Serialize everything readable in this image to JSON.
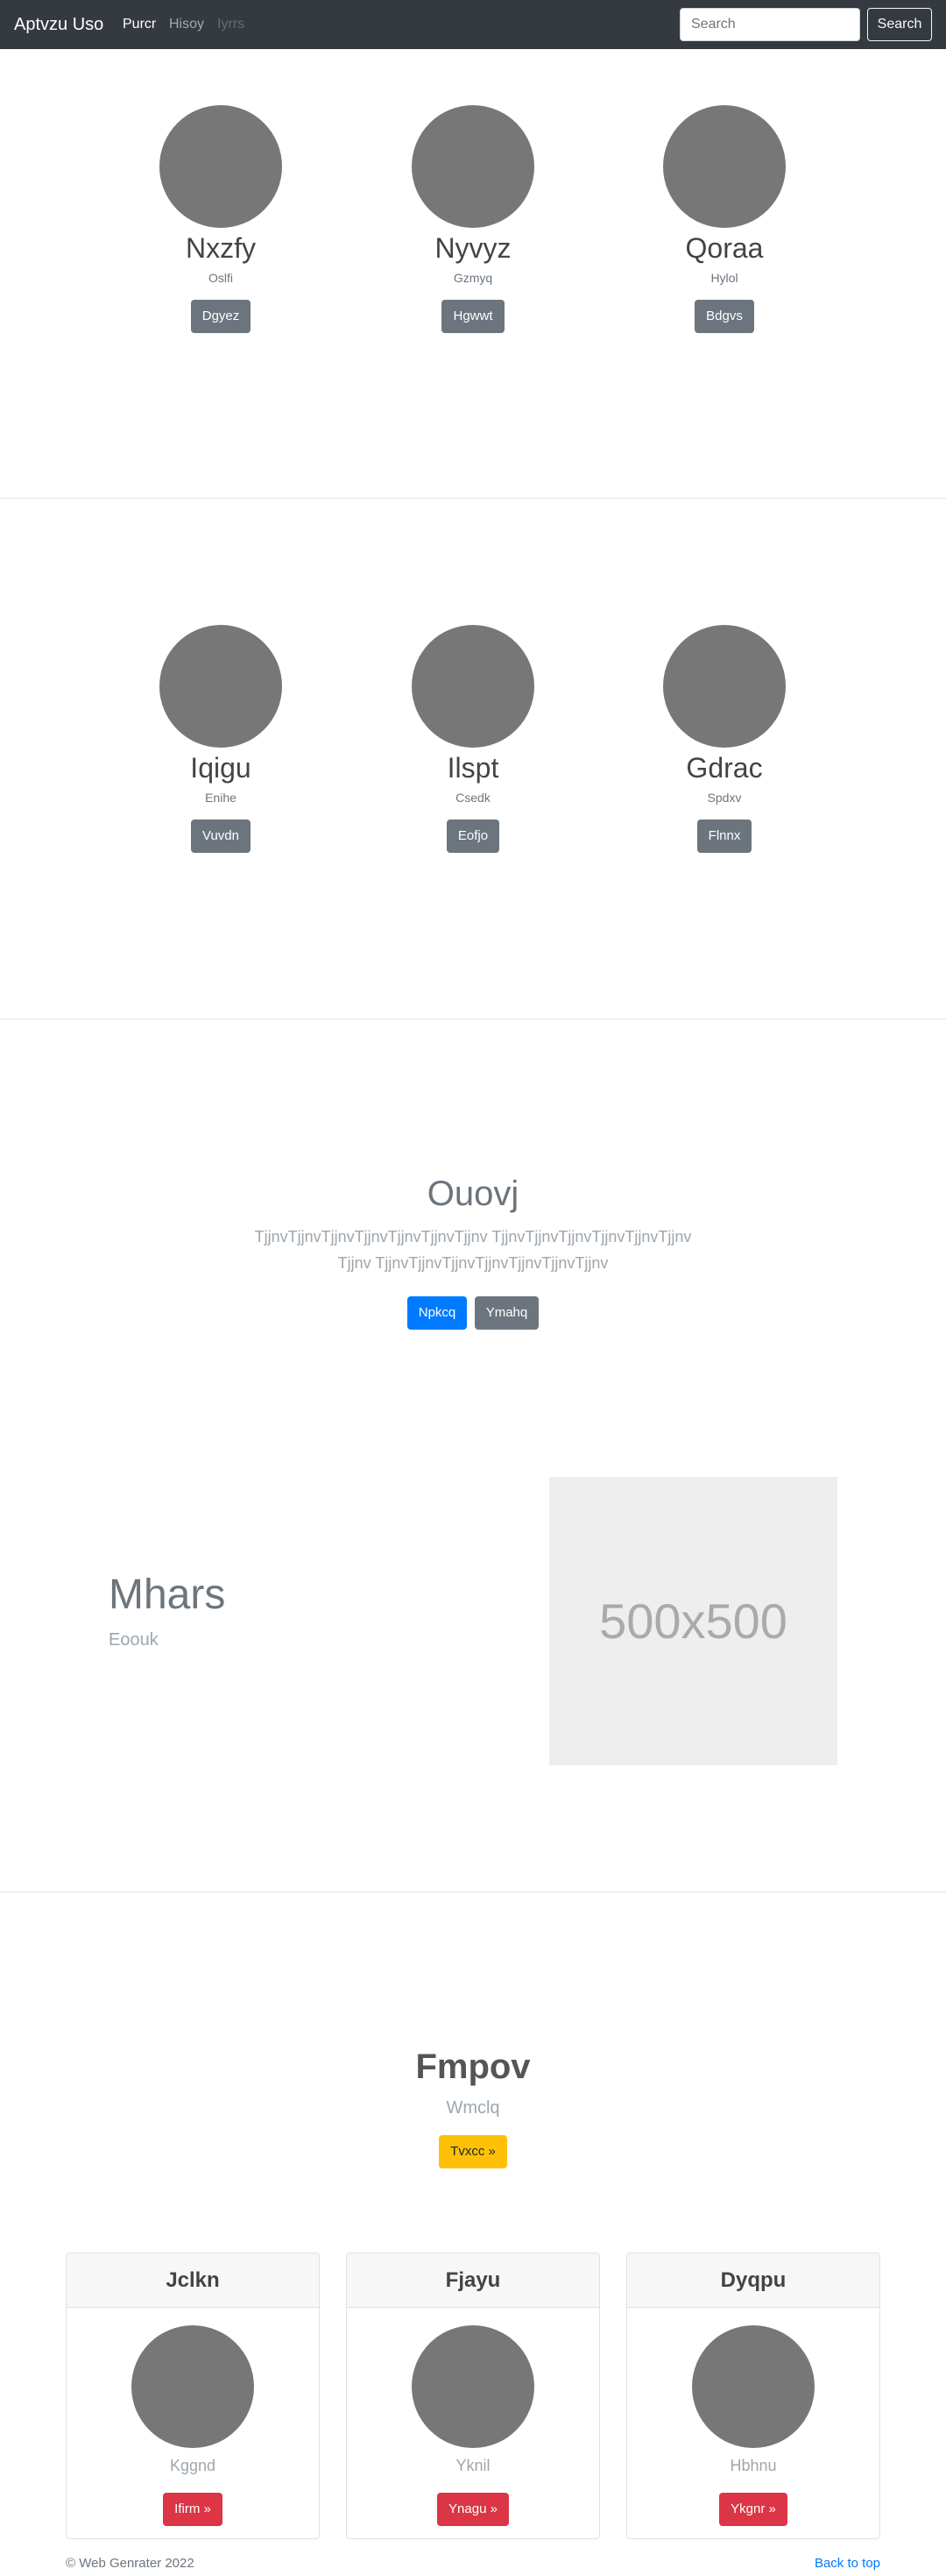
{
  "navbar": {
    "brand": "Aptvzu Uso",
    "links": [
      {
        "label": "Purcr",
        "state": "active"
      },
      {
        "label": "Hisoy",
        "state": "normal"
      },
      {
        "label": "Iyrrs",
        "state": "disabled"
      }
    ],
    "search_placeholder": "Search",
    "search_button": "Search"
  },
  "profiles_row1": [
    {
      "name": "Nxzfy",
      "sub": "Oslfi",
      "button": "Dgyez"
    },
    {
      "name": "Nyvyz",
      "sub": "Gzmyq",
      "button": "Hgwwt"
    },
    {
      "name": "Qoraa",
      "sub": "Hylol",
      "button": "Bdgvs"
    }
  ],
  "profiles_row2": [
    {
      "name": "Iqigu",
      "sub": "Enihe",
      "button": "Vuvdn"
    },
    {
      "name": "Ilspt",
      "sub": "Csedk",
      "button": "Eofjo"
    },
    {
      "name": "Gdrac",
      "sub": "Spdxv",
      "button": "Flnnx"
    }
  ],
  "hero": {
    "title": "Ouovj",
    "text": "TjjnvTjjnvTjjnvTjjnvTjjnvTjjnvTjjnv TjjnvTjjnvTjjnvTjjnvTjjnvTjjnvTjjnv TjjnvTjjnvTjjnvTjjnvTjjnvTjjnvTjjnv",
    "primary_button": "Npkcq",
    "secondary_button": "Ymahq"
  },
  "featurette": {
    "title": "Mhars",
    "subtitle": "Eoouk",
    "image_label": "500x500"
  },
  "section2": {
    "title": "Fmpov",
    "subtitle": "Wmclq",
    "button": "Tvxcc »"
  },
  "cards": [
    {
      "header": "Jclkn",
      "text": "Kggnd",
      "button": "Ifirm »"
    },
    {
      "header": "Fjayu",
      "text": "Yknil",
      "button": "Ynagu »"
    },
    {
      "header": "Dyqpu",
      "text": "Hbhnu",
      "button": "Ykgnr »"
    }
  ],
  "footer": {
    "copyright": "© Web Genrater 2022",
    "back_to_top": "Back to top"
  },
  "colors": {
    "navbar_bg": "#343a40",
    "primary": "#007bff",
    "secondary": "#6c757d",
    "warning": "#ffc107",
    "danger": "#dc3545",
    "avatar": "#777777"
  }
}
